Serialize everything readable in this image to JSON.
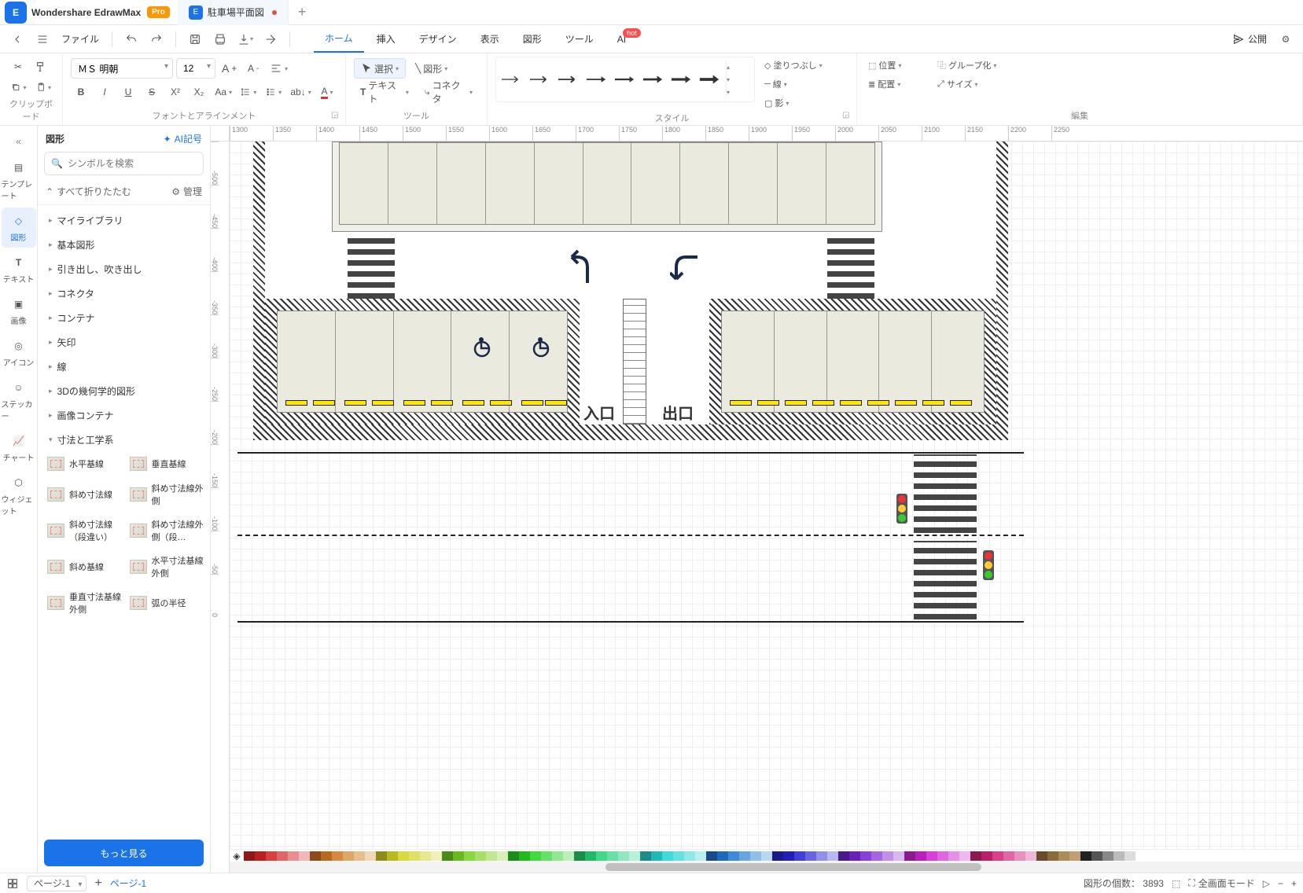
{
  "app": {
    "name": "Wondershare EdrawMax",
    "badge": "Pro"
  },
  "tab": {
    "title": "駐車場平面図"
  },
  "toolbar": {
    "file": "ファイル",
    "publish": "公開"
  },
  "menus": [
    "ホーム",
    "挿入",
    "デザイン",
    "表示",
    "図形",
    "ツール",
    "AI"
  ],
  "hot_badge": "hot",
  "ribbon": {
    "clipboard": "クリップボード",
    "font_group": "フォントとアラインメント",
    "tool_group": "ツール",
    "style_group": "スタイル",
    "edit_group": "編集",
    "font_name": "ＭＳ 明朝",
    "font_size": "12",
    "select": "選択",
    "shape": "図形",
    "text": "テキスト",
    "connector": "コネクタ",
    "fill": "塗りつぶし",
    "line": "線",
    "shadow": "影",
    "pos": "位置",
    "align": "配置",
    "group": "グループ化",
    "size": "サイズ"
  },
  "rail": {
    "template": "テンプレート",
    "shape": "図形",
    "text": "テキスト",
    "image": "画像",
    "icon": "アイコン",
    "sticker": "ステッカー",
    "chart": "チャート",
    "widget": "ウィジェット"
  },
  "panel": {
    "title": "図形",
    "ai": "AI記号",
    "search_ph": "シンボルを検索",
    "collapse": "すべて折りたたむ",
    "manage": "管理",
    "cats": [
      "マイライブラリ",
      "基本図形",
      "引き出し、吹き出し",
      "コネクタ",
      "コンテナ",
      "矢印",
      "線",
      "3Dの幾何学的図形",
      "画像コンテナ"
    ],
    "open_cat": "寸法と工学系",
    "shapes": [
      "水平基線",
      "垂直基線",
      "斜め寸法線",
      "斜め寸法線外側",
      "斜め寸法線（段違い）",
      "斜め寸法線外側（段…",
      "斜め基線",
      "水平寸法基線外側",
      "垂直寸法基線外側",
      "弧の半径"
    ],
    "more": "もっと見る"
  },
  "ruler_h": [
    "1300",
    "1350",
    "1400",
    "1450",
    "1500",
    "1550",
    "1600",
    "1650",
    "1700",
    "1750",
    "1800",
    "1850",
    "1900",
    "1950",
    "2000",
    "2050",
    "2100",
    "2150",
    "2200",
    "2250"
  ],
  "ruler_v": [
    "-500",
    "-450",
    "-400",
    "-350",
    "-300",
    "-250",
    "-200",
    "-150",
    "-100",
    "-50",
    "0"
  ],
  "canvas": {
    "entrance": "入口",
    "exit": "出口"
  },
  "status": {
    "page_sel": "ページ-1",
    "page_active": "ページ-1",
    "count_label": "図形の個数：",
    "count": "3893",
    "fullscreen": "全画面モード"
  },
  "palette": [
    "#8c1a1a",
    "#b92020",
    "#d94040",
    "#e06666",
    "#e89090",
    "#f0b8b8",
    "#8c4a1a",
    "#b96820",
    "#d98840",
    "#e0a666",
    "#e8c090",
    "#f0d8b8",
    "#8c8c1a",
    "#b9b920",
    "#d9d940",
    "#e0e066",
    "#e8e890",
    "#f0f0b8",
    "#4a8c1a",
    "#68b920",
    "#88d940",
    "#a6e066",
    "#c0e890",
    "#d8f0b8",
    "#1a8c1a",
    "#20b920",
    "#40d940",
    "#66e066",
    "#90e890",
    "#b8f0b8",
    "#1a8c4a",
    "#20b968",
    "#40d988",
    "#66e0a6",
    "#90e8c0",
    "#b8f0d8",
    "#1a8c8c",
    "#20b9b9",
    "#40d9d9",
    "#66e0e0",
    "#90e8e8",
    "#b8f0f0",
    "#1a4a8c",
    "#2068b9",
    "#4088d9",
    "#66a6e0",
    "#90c0e8",
    "#b8d8f0",
    "#1a1a8c",
    "#2020b9",
    "#4040d9",
    "#6666e0",
    "#9090e8",
    "#b8b8f0",
    "#4a1a8c",
    "#6820b9",
    "#8840d9",
    "#a666e0",
    "#c090e8",
    "#d8b8f0",
    "#8c1a8c",
    "#b920b9",
    "#d940d9",
    "#e066e0",
    "#e890e8",
    "#f0b8f0",
    "#8c1a4a",
    "#b92068",
    "#d94088",
    "#e066a6",
    "#e890c0",
    "#f0b8d8",
    "#6b4a2a",
    "#8c6b3a",
    "#ad8c5a",
    "#c0a070",
    "#222",
    "#555",
    "#888",
    "#bbb",
    "#ddd",
    "#fff"
  ]
}
